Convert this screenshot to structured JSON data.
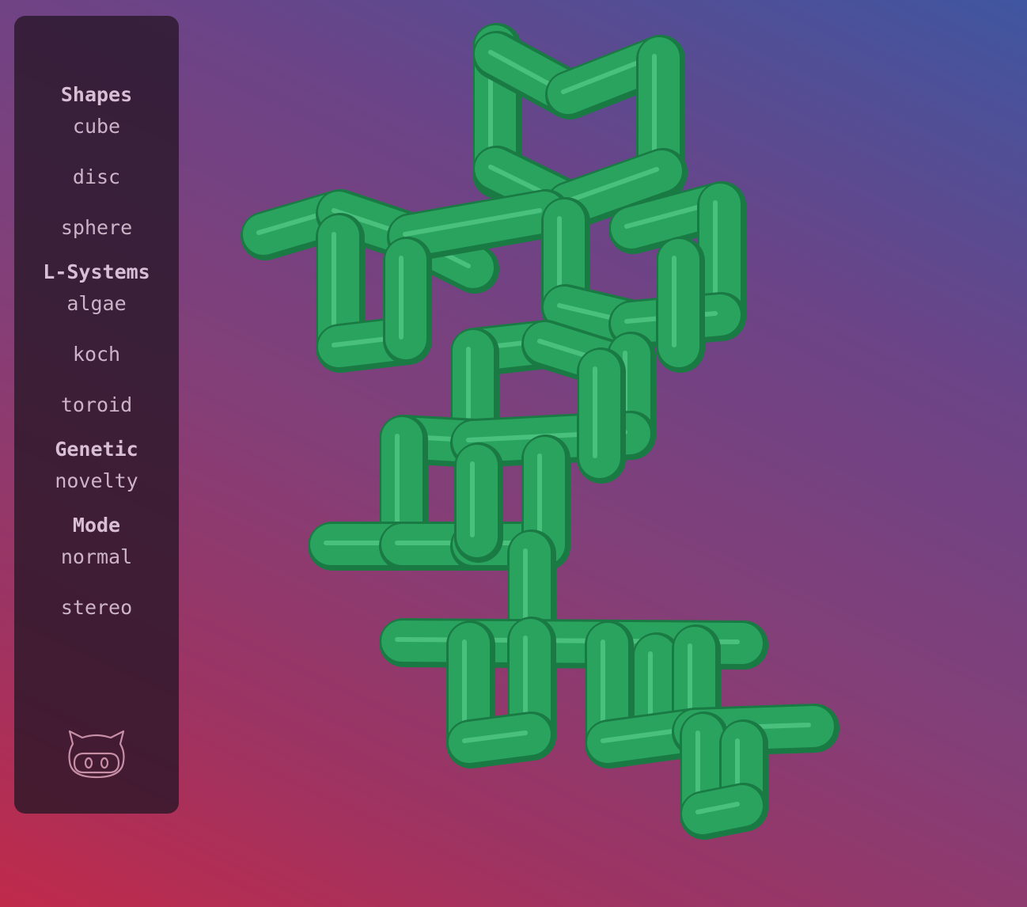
{
  "sidebar": {
    "sections": [
      {
        "title": "Shapes",
        "items": [
          "cube",
          "disc",
          "sphere"
        ]
      },
      {
        "title": "L-Systems",
        "items": [
          "algae",
          "koch",
          "toroid"
        ]
      },
      {
        "title": "Genetic",
        "items": [
          "novelty"
        ]
      },
      {
        "title": "Mode",
        "items": [
          "normal",
          "stereo"
        ]
      }
    ]
  },
  "logo": {
    "icon": "github-octocat-icon"
  },
  "viewport": {
    "object": "green-tube-lsystem-structure",
    "tube_color": "#2aa35e",
    "highlight_color": "#6fe6a4",
    "shadow_color": "#1a7a44"
  },
  "theme": {
    "bg_top_right": "#3f56a0",
    "bg_bottom_left": "#c02a4a",
    "panel_bg": "#2a1828",
    "text_color": "#d0b6ca"
  }
}
